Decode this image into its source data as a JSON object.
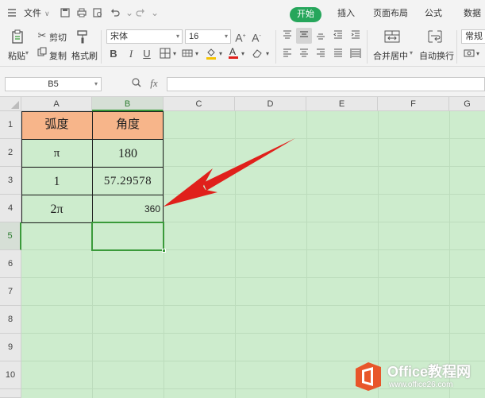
{
  "menubar": {
    "file_label": "文件",
    "tabs": [
      "开始",
      "插入",
      "页面布局",
      "公式",
      "数据"
    ]
  },
  "ribbon": {
    "paste_label": "粘贴",
    "cut_label": "剪切",
    "copy_label": "复制",
    "format_painter_label": "格式刷",
    "font_name": "宋体",
    "font_size": "16",
    "merge_label": "合并居中",
    "wrap_label": "自动换行",
    "number_format": "常规"
  },
  "formula_bar": {
    "name_box": "B5",
    "fx_label": "fx",
    "value": ""
  },
  "grid": {
    "columns": [
      "A",
      "B",
      "C",
      "D",
      "E",
      "F",
      "G"
    ],
    "rows": [
      "1",
      "2",
      "3",
      "4",
      "5",
      "6",
      "7",
      "8",
      "9",
      "10"
    ],
    "selected_cell": "B5",
    "table": {
      "headers": [
        "弧度",
        "角度"
      ],
      "rows": [
        [
          "π",
          "180"
        ],
        [
          "1",
          "57.29578"
        ],
        [
          "2π",
          "360"
        ]
      ]
    }
  },
  "watermark": {
    "brand": "Office教程网",
    "url": "www.office26.com"
  },
  "colors": {
    "accent": "#26a65b",
    "sheet_background": "#cdeccd",
    "header_fill": "#f7b58a",
    "annotation_arrow": "#e0201b",
    "selection": "#3a9a3a"
  }
}
